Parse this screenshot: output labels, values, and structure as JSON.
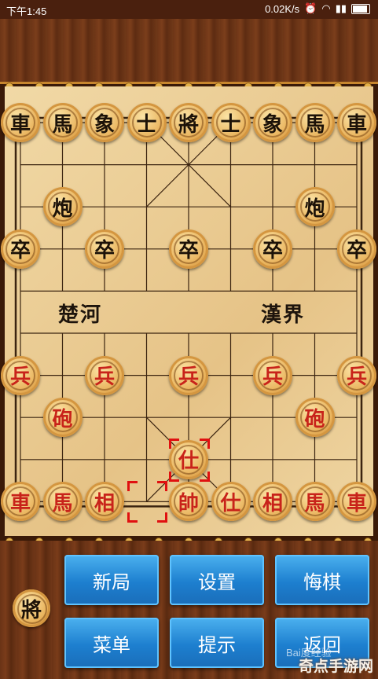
{
  "status_bar": {
    "time": "下午1:45",
    "speed": "0.02K/s"
  },
  "board": {
    "river_left": "楚河",
    "river_right": "漢界",
    "pieces": [
      {
        "t": "車",
        "side": "black",
        "c": 0,
        "r": 0
      },
      {
        "t": "馬",
        "side": "black",
        "c": 1,
        "r": 0
      },
      {
        "t": "象",
        "side": "black",
        "c": 2,
        "r": 0
      },
      {
        "t": "士",
        "side": "black",
        "c": 3,
        "r": 0
      },
      {
        "t": "將",
        "side": "black",
        "c": 4,
        "r": 0
      },
      {
        "t": "士",
        "side": "black",
        "c": 5,
        "r": 0
      },
      {
        "t": "象",
        "side": "black",
        "c": 6,
        "r": 0
      },
      {
        "t": "馬",
        "side": "black",
        "c": 7,
        "r": 0
      },
      {
        "t": "車",
        "side": "black",
        "c": 8,
        "r": 0
      },
      {
        "t": "炮",
        "side": "black",
        "c": 1,
        "r": 2
      },
      {
        "t": "炮",
        "side": "black",
        "c": 7,
        "r": 2
      },
      {
        "t": "卒",
        "side": "black",
        "c": 0,
        "r": 3
      },
      {
        "t": "卒",
        "side": "black",
        "c": 2,
        "r": 3
      },
      {
        "t": "卒",
        "side": "black",
        "c": 4,
        "r": 3
      },
      {
        "t": "卒",
        "side": "black",
        "c": 6,
        "r": 3
      },
      {
        "t": "卒",
        "side": "black",
        "c": 8,
        "r": 3
      },
      {
        "t": "兵",
        "side": "red",
        "c": 0,
        "r": 6
      },
      {
        "t": "兵",
        "side": "red",
        "c": 2,
        "r": 6
      },
      {
        "t": "兵",
        "side": "red",
        "c": 4,
        "r": 6
      },
      {
        "t": "兵",
        "side": "red",
        "c": 6,
        "r": 6
      },
      {
        "t": "兵",
        "side": "red",
        "c": 8,
        "r": 6
      },
      {
        "t": "砲",
        "side": "red",
        "c": 1,
        "r": 7
      },
      {
        "t": "砲",
        "side": "red",
        "c": 7,
        "r": 7
      },
      {
        "t": "仕",
        "side": "red",
        "c": 4,
        "r": 8
      },
      {
        "t": "車",
        "side": "red",
        "c": 0,
        "r": 9
      },
      {
        "t": "馬",
        "side": "red",
        "c": 1,
        "r": 9
      },
      {
        "t": "相",
        "side": "red",
        "c": 2,
        "r": 9
      },
      {
        "t": "帥",
        "side": "red",
        "c": 4,
        "r": 9
      },
      {
        "t": "仕",
        "side": "red",
        "c": 5,
        "r": 9
      },
      {
        "t": "相",
        "side": "red",
        "c": 6,
        "r": 9
      },
      {
        "t": "馬",
        "side": "red",
        "c": 7,
        "r": 9
      },
      {
        "t": "車",
        "side": "red",
        "c": 8,
        "r": 9
      }
    ]
  },
  "turn_indicator": "將",
  "buttons": {
    "new_game": "新局",
    "settings": "设置",
    "undo": "悔棋",
    "menu": "菜单",
    "hint": "提示",
    "back": "返回"
  },
  "watermark": "奇点手游网",
  "baidu_mark": "Bai度经验"
}
